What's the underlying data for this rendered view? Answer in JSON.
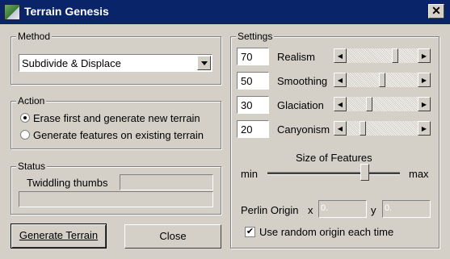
{
  "window": {
    "title": "Terrain Genesis",
    "close_glyph": "✕"
  },
  "method": {
    "legend": "Method",
    "selected": "Subdivide & Displace"
  },
  "action": {
    "legend": "Action",
    "options": [
      {
        "label": "Erase first and generate new terrain",
        "selected": true
      },
      {
        "label": "Generate features on existing terrain",
        "selected": false
      }
    ]
  },
  "status": {
    "legend": "Status",
    "label": "Twiddling thumbs",
    "field_value": "",
    "progress": 0
  },
  "settings": {
    "legend": "Settings",
    "sliders": [
      {
        "label": "Realism",
        "value": "70",
        "level": 0.7
      },
      {
        "label": "Smoothing",
        "value": "50",
        "level": 0.5
      },
      {
        "label": "Glaciation",
        "value": "30",
        "level": 0.3
      },
      {
        "label": "Canyonism",
        "value": "20",
        "level": 0.2
      }
    ],
    "features": {
      "title": "Size of Features",
      "min_label": "min",
      "max_label": "max",
      "level": 0.75
    },
    "perlin": {
      "label": "Perlin Origin",
      "x_label": "x",
      "x_value": "0.",
      "y_label": "y",
      "y_value": "0."
    },
    "random_origin": {
      "label": "Use random origin each time",
      "checked": true
    }
  },
  "buttons": {
    "generate": "Generate Terrain",
    "close": "Close"
  }
}
